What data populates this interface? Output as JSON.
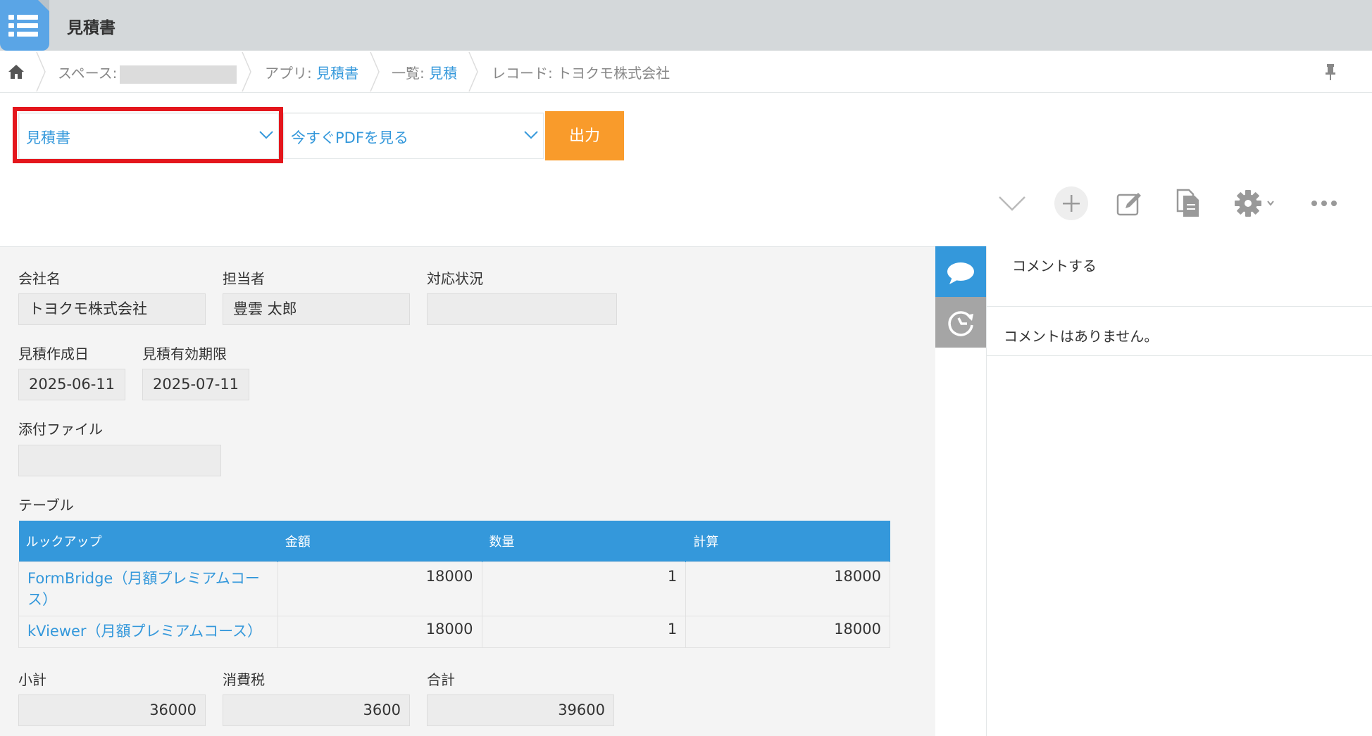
{
  "header": {
    "title": "見積書"
  },
  "breadcrumb": {
    "space_prefix": "スペース:",
    "app_prefix": "アプリ:",
    "app_name": "見積書",
    "view_prefix": "一覧:",
    "view_name": "見積",
    "record": "レコード: トヨクモ株式会社"
  },
  "toolbar": {
    "template_select": "見積書",
    "action_select": "今すぐPDFを見る",
    "output_button": "出力",
    "highlight_color": "#e4161c",
    "accent_color": "#3498db",
    "output_color": "#f99b2b"
  },
  "actions": [
    "chevron-down-icon",
    "add-icon",
    "edit-icon",
    "duplicate-icon",
    "gear-icon",
    "more-icon"
  ],
  "fields": {
    "company": {
      "label": "会社名",
      "value": "トヨクモ株式会社"
    },
    "person": {
      "label": "担当者",
      "value": "豊雲 太郎"
    },
    "status": {
      "label": "対応状況",
      "value": ""
    },
    "created": {
      "label": "見積作成日",
      "value": "2025-06-11"
    },
    "expiry": {
      "label": "見積有効期限",
      "value": "2025-07-11"
    },
    "attachment": {
      "label": "添付ファイル",
      "value": ""
    },
    "table_label": "テーブル",
    "subtotal": {
      "label": "小計",
      "value": "36000"
    },
    "tax": {
      "label": "消費税",
      "value": "3600"
    },
    "total": {
      "label": "合計",
      "value": "39600"
    }
  },
  "table": {
    "headers": [
      "ルックアップ",
      "金額",
      "数量",
      "計算"
    ],
    "rows": [
      {
        "lookup": "FormBridge（月額プレミアムコース）",
        "amount": "18000",
        "qty": "1",
        "calc": "18000"
      },
      {
        "lookup": "kViewer（月額プレミアムコース）",
        "amount": "18000",
        "qty": "1",
        "calc": "18000"
      }
    ]
  },
  "comments": {
    "input_placeholder": "コメントする",
    "empty_message": "コメントはありません。"
  }
}
